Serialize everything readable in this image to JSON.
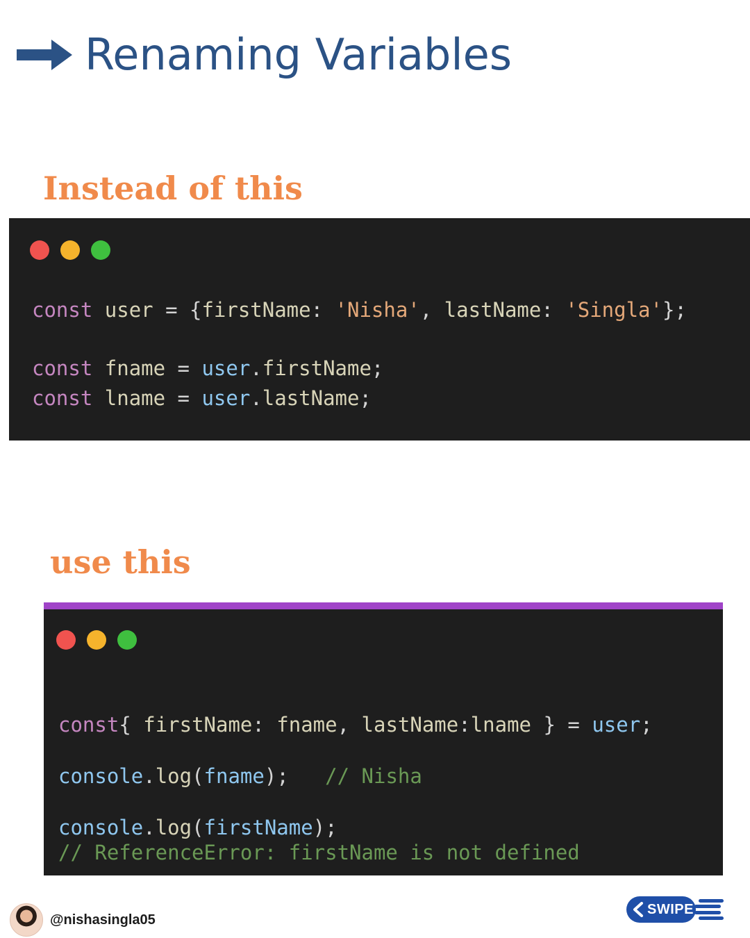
{
  "header": {
    "title": "Renaming Variables",
    "arrow_color": "#2b5285"
  },
  "sections": [
    {
      "label": "Instead of this",
      "code_lines": [
        [
          {
            "t": "const",
            "c": "kw"
          },
          {
            "t": " user ",
            "c": "ident"
          },
          {
            "t": "= {",
            "c": "pun"
          },
          {
            "t": "firstName",
            "c": "ident"
          },
          {
            "t": ": ",
            "c": "pun"
          },
          {
            "t": "'Nisha'",
            "c": "str"
          },
          {
            "t": ", ",
            "c": "pun"
          },
          {
            "t": "lastName",
            "c": "ident"
          },
          {
            "t": ": ",
            "c": "pun"
          },
          {
            "t": "'Singla'",
            "c": "str"
          },
          {
            "t": "};",
            "c": "pun"
          }
        ],
        [],
        [
          {
            "t": "const",
            "c": "kw"
          },
          {
            "t": " fname ",
            "c": "ident"
          },
          {
            "t": "= ",
            "c": "pun"
          },
          {
            "t": "user",
            "c": "obj"
          },
          {
            "t": ".",
            "c": "pun"
          },
          {
            "t": "firstName",
            "c": "ident"
          },
          {
            "t": ";",
            "c": "pun"
          }
        ],
        [
          {
            "t": "const",
            "c": "kw"
          },
          {
            "t": " lname ",
            "c": "ident"
          },
          {
            "t": "= ",
            "c": "pun"
          },
          {
            "t": "user",
            "c": "obj"
          },
          {
            "t": ".",
            "c": "pun"
          },
          {
            "t": "lastName",
            "c": "ident"
          },
          {
            "t": ";",
            "c": "pun"
          }
        ]
      ]
    },
    {
      "label": "use this",
      "code_lines": [
        [
          {
            "t": "const",
            "c": "kw"
          },
          {
            "t": "{ ",
            "c": "pun"
          },
          {
            "t": "firstName",
            "c": "ident"
          },
          {
            "t": ": ",
            "c": "pun"
          },
          {
            "t": "fname",
            "c": "ident"
          },
          {
            "t": ", ",
            "c": "pun"
          },
          {
            "t": "lastName",
            "c": "ident"
          },
          {
            "t": ":",
            "c": "pun"
          },
          {
            "t": "lname",
            "c": "ident"
          },
          {
            "t": " } = ",
            "c": "pun"
          },
          {
            "t": "user",
            "c": "obj"
          },
          {
            "t": ";",
            "c": "pun"
          }
        ],
        [],
        [
          {
            "t": "console",
            "c": "obj"
          },
          {
            "t": ".",
            "c": "pun"
          },
          {
            "t": "log",
            "c": "ident"
          },
          {
            "t": "(",
            "c": "pun"
          },
          {
            "t": "fname",
            "c": "obj"
          },
          {
            "t": ");   ",
            "c": "pun"
          },
          {
            "t": "// Nisha",
            "c": "cmt"
          }
        ],
        [],
        [
          {
            "t": "console",
            "c": "obj"
          },
          {
            "t": ".",
            "c": "pun"
          },
          {
            "t": "log",
            "c": "ident"
          },
          {
            "t": "(",
            "c": "pun"
          },
          {
            "t": "firstName",
            "c": "obj"
          },
          {
            "t": ");",
            "c": "pun"
          }
        ],
        [
          {
            "t": "// ReferenceError: firstName is not defined",
            "c": "cmt"
          }
        ]
      ]
    }
  ],
  "window_controls": {
    "red": "#f0534f",
    "yellow": "#f5b32c",
    "green": "#3fbf3f"
  },
  "footer": {
    "handle": "@nishasingla05",
    "swipe_label": "SWIPE"
  }
}
